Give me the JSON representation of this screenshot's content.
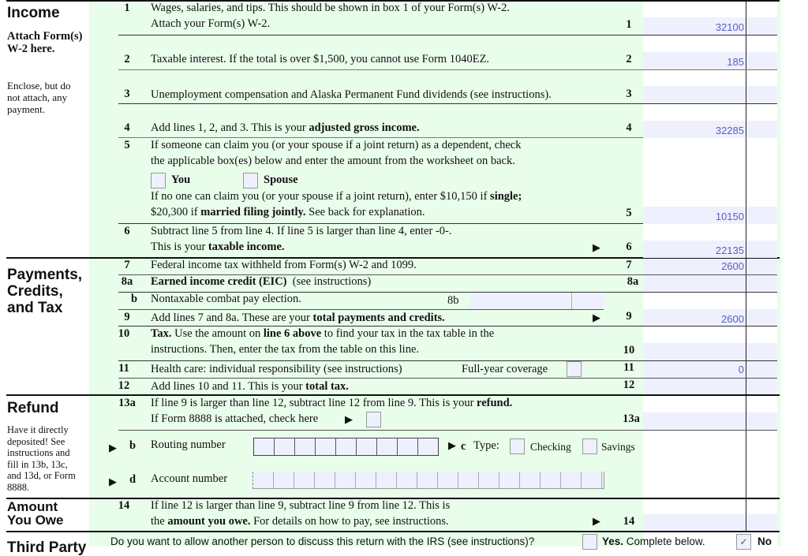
{
  "sections": {
    "income": {
      "title": "Income",
      "attach": "Attach Form(s) W-2 here.",
      "enclose": "Enclose, but do not attach, any payment."
    },
    "payments": {
      "title_line1": "Payments,",
      "title_line2": "Credits,",
      "title_line3": "and Tax"
    },
    "refund": {
      "title": "Refund",
      "note": "Have it directly deposited! See instructions and fill in 13b, 13c, and 13d, or Form 8888."
    },
    "owe": {
      "title_line1": "Amount",
      "title_line2": "You Owe"
    },
    "third_party": {
      "title": "Third Party"
    }
  },
  "lines": {
    "l1": {
      "num": "1",
      "text1": "Wages, salaries, and tips. This should be shown in box 1 of your Form(s) W-2.",
      "text2": "Attach your Form(s) W-2.",
      "value": "32100"
    },
    "l2": {
      "num": "2",
      "text": "Taxable interest. If the total is over $1,500, you cannot use Form 1040EZ.",
      "value": "185"
    },
    "l3": {
      "num": "3",
      "text": "Unemployment compensation and Alaska Permanent Fund dividends (see instructions).",
      "value": ""
    },
    "l4": {
      "num": "4",
      "text_a": "Add lines 1, 2, and 3. This is your ",
      "text_b": "adjusted gross income.",
      "value": "32285"
    },
    "l5": {
      "num": "5",
      "text1": "If someone can claim you (or your spouse if a joint return) as a dependent, check",
      "text2": "the applicable box(es) below and enter the amount from the worksheet on back.",
      "you": "You",
      "spouse": "Spouse",
      "text3_a": "If no one can claim you (or your spouse if a joint return), enter $10,150 if ",
      "text3_b": "single;",
      "text4_a": "$20,300 if ",
      "text4_b": "married filing jointly.",
      "text4_c": " See back for explanation.",
      "value": "10150"
    },
    "l6": {
      "num": "6",
      "text1": "Subtract line 5 from line 4. If line 5 is larger than line 4, enter -0-.",
      "text2_a": "This is your ",
      "text2_b": "taxable income.",
      "value": "22135"
    },
    "l7": {
      "num": "7",
      "text": "Federal income tax withheld from Form(s) W-2 and 1099.",
      "value": "2600"
    },
    "l8a": {
      "num": "8a",
      "text_a": "Earned income credit (EIC)",
      "text_b": "  (see instructions)",
      "value": ""
    },
    "l8b": {
      "num": "b",
      "text": "Nontaxable combat pay election.",
      "label": "8b"
    },
    "l9": {
      "num": "9",
      "text_a": "Add lines 7 and 8a. These are your ",
      "text_b": "total payments and credits.",
      "value": "2600"
    },
    "l10": {
      "num": "10",
      "t_a": "Tax.",
      "t_b": " Use the amount on ",
      "t_c": "line 6 above",
      "t_d": " to find your tax in the tax table in the",
      "text2": "instructions. Then, enter the tax from the table on this line.",
      "value": ""
    },
    "l11": {
      "num": "11",
      "text": "Health care: individual responsibility (see instructions)",
      "coverage": "Full-year coverage",
      "value": "0"
    },
    "l12": {
      "num": "12",
      "text_a": "Add lines 10 and 11. This is your ",
      "text_b": "total tax.",
      "value": ""
    },
    "l13a": {
      "num": "13a",
      "text_a": "If line 9 is larger than line 12, subtract line 12 from line 9. This is your ",
      "text_b": "refund.",
      "text2": "If Form 8888 is attached, check here",
      "value": ""
    },
    "l13b": {
      "num": "b",
      "text": "Routing number",
      "c": "c",
      "type": "Type:",
      "checking": "Checking",
      "savings": "Savings"
    },
    "l13d": {
      "num": "d",
      "text": "Account number"
    },
    "l14": {
      "num": "14",
      "text1": "If line 12 is larger than line 9, subtract line 9 from line 12. This is",
      "text2_a": "the ",
      "text2_b": "amount you owe.",
      "text2_c": " For details on how to pay, see instructions.",
      "value": ""
    }
  },
  "third_party_row": {
    "question": "Do you want to allow another person to discuss this return with the IRS (see instructions)?",
    "yes_a": "Yes.",
    "yes_b": " Complete below.",
    "no": "No",
    "no_checked": true
  },
  "colors": {
    "green": "#e9fdeb",
    "input": "#eef1fd",
    "value_text": "#5b5bc4"
  }
}
